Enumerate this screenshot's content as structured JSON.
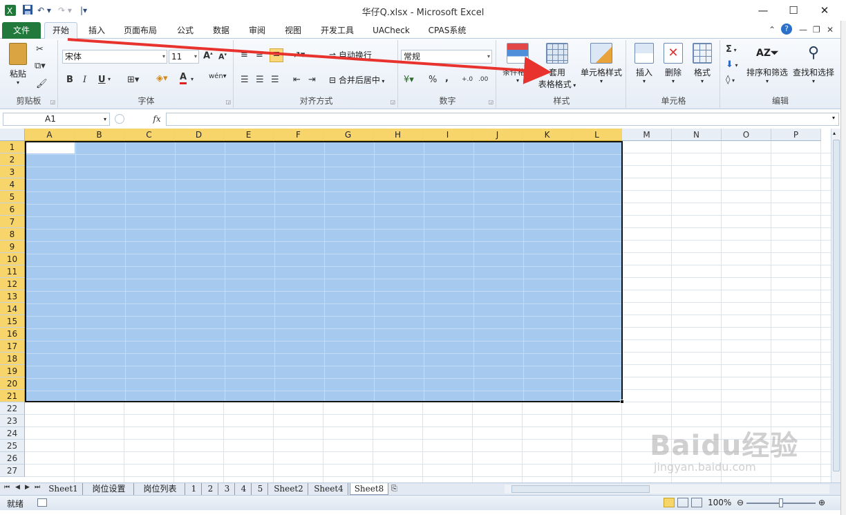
{
  "window": {
    "title": "华仔Q.xlsx  -  Microsoft Excel",
    "icon": "excel-icon",
    "controls": {
      "minimize": "—",
      "maximize": "☐",
      "close": "✕"
    }
  },
  "qat": {
    "save": "save-icon",
    "undo": "undo-icon",
    "redo": "redo-icon",
    "customize": "customize-icon"
  },
  "tabs": [
    {
      "label": "文件"
    },
    {
      "label": "开始"
    },
    {
      "label": "插入"
    },
    {
      "label": "页面布局"
    },
    {
      "label": "公式"
    },
    {
      "label": "数据"
    },
    {
      "label": "审阅"
    },
    {
      "label": "视图"
    },
    {
      "label": "开发工具"
    },
    {
      "label": "UACheck"
    },
    {
      "label": "CPAS系统"
    }
  ],
  "ribbon": {
    "clipboard": {
      "paste": "粘贴",
      "label": "剪贴板"
    },
    "font": {
      "name": "宋体",
      "size": "11",
      "bold": "B",
      "italic": "I",
      "underline": "U",
      "label": "字体"
    },
    "alignment": {
      "wrap": "自动换行",
      "merge": "合并后居中",
      "label": "对齐方式"
    },
    "number": {
      "format": "常规",
      "percent": "%",
      "comma": ",",
      "inc": "+.0",
      "dec": ".00",
      "label": "数字"
    },
    "styles": {
      "conditional": "条件格式",
      "table_format_1": "套用",
      "table_format_2": "表格格式",
      "cell_styles": "单元格样式",
      "label": "样式"
    },
    "cells": {
      "insert": "插入",
      "delete": "删除",
      "format": "格式",
      "label": "单元格"
    },
    "editing": {
      "sigma": "Σ",
      "sort": "排序和筛选",
      "find": "查找和选择",
      "label": "编辑"
    }
  },
  "formula_bar": {
    "name_box": "A1",
    "fx": "fx",
    "formula": ""
  },
  "columns": [
    "A",
    "B",
    "C",
    "D",
    "E",
    "F",
    "G",
    "H",
    "I",
    "J",
    "K",
    "L",
    "M",
    "N",
    "O",
    "P"
  ],
  "rows": [
    "1",
    "2",
    "3",
    "4",
    "5",
    "6",
    "7",
    "8",
    "9",
    "10",
    "11",
    "12",
    "13",
    "14",
    "15",
    "16",
    "17",
    "18",
    "19",
    "20",
    "21",
    "22",
    "23",
    "24",
    "25",
    "26",
    "27"
  ],
  "selection": {
    "range": "A1:L21",
    "active": "A1",
    "color": "#a6c9ef"
  },
  "sheets": [
    "Sheet1",
    "岗位设置",
    "岗位列表",
    "1",
    "2",
    "3",
    "4",
    "5",
    "Sheet2",
    "Sheet4",
    "Sheet8"
  ],
  "active_sheet": "Sheet8",
  "status": {
    "mode": "就绪",
    "zoom": "100%",
    "zoom_level": 1.0
  },
  "watermark": {
    "brand": "Baidu经验",
    "url": "jingyan.baidu.com"
  },
  "colors": {
    "accent": "#217a3b",
    "header_selected": "#f7d56b",
    "arrow": "#e8322d"
  }
}
